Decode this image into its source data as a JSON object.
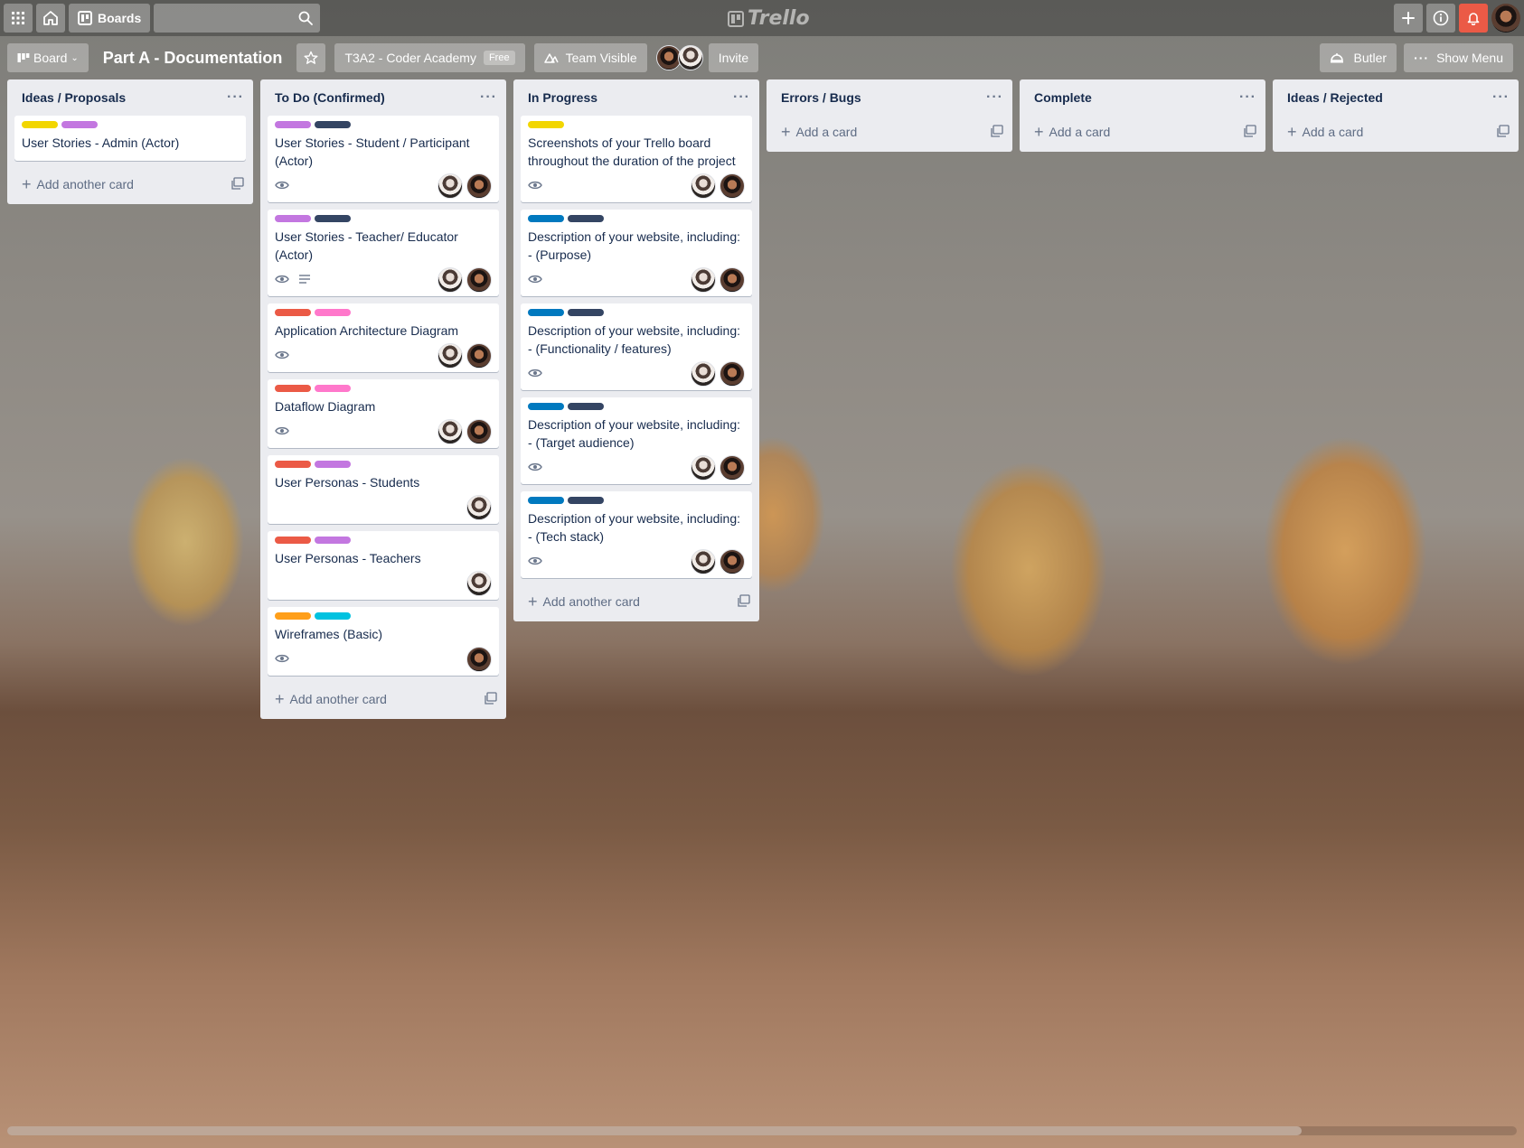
{
  "header": {
    "boards_label": "Boards",
    "logo_text": "Trello",
    "search_placeholder": ""
  },
  "board": {
    "view_label": "Board",
    "title": "Part A - Documentation",
    "team_label": "T3A2 - Coder Academy",
    "team_badge": "Free",
    "visibility_label": "Team Visible",
    "invite_label": "Invite",
    "butler_label": "Butler",
    "show_menu_label": "Show Menu"
  },
  "colors": {
    "yellow": "#f2d600",
    "purple": "#c377e0",
    "navy": "#344563",
    "red": "#eb5a46",
    "pink": "#ff78cb",
    "orange": "#ff9f1a",
    "sky": "#00c2e0",
    "blue": "#0079bf"
  },
  "lists": [
    {
      "title": "Ideas / Proposals",
      "add_label": "Add another card",
      "cards": [
        {
          "labels": [
            "yellow",
            "purple"
          ],
          "title": "User Stories - Admin (Actor)",
          "watch": false,
          "desc": false,
          "members": []
        }
      ]
    },
    {
      "title": "To Do (Confirmed)",
      "add_label": "Add another card",
      "cards": [
        {
          "labels": [
            "purple",
            "navy"
          ],
          "title": "User Stories - Student / Participant (Actor)",
          "watch": true,
          "desc": false,
          "members": [
            "a",
            "b"
          ]
        },
        {
          "labels": [
            "purple",
            "navy"
          ],
          "title": "User Stories - Teacher/ Educator (Actor)",
          "watch": true,
          "desc": true,
          "members": [
            "a",
            "b"
          ]
        },
        {
          "labels": [
            "red",
            "pink"
          ],
          "title": "Application Architecture Diagram",
          "watch": true,
          "desc": false,
          "members": [
            "a",
            "b"
          ]
        },
        {
          "labels": [
            "red",
            "pink"
          ],
          "title": "Dataflow Diagram",
          "watch": true,
          "desc": false,
          "members": [
            "a",
            "b"
          ]
        },
        {
          "labels": [
            "red",
            "purple"
          ],
          "title": "User Personas - Students",
          "watch": false,
          "desc": false,
          "members": [
            "a"
          ]
        },
        {
          "labels": [
            "red",
            "purple"
          ],
          "title": "User Personas - Teachers",
          "watch": false,
          "desc": false,
          "members": [
            "a"
          ]
        },
        {
          "labels": [
            "orange",
            "sky"
          ],
          "title": "Wireframes (Basic)",
          "watch": true,
          "desc": false,
          "members": [
            "b"
          ]
        }
      ]
    },
    {
      "title": "In Progress",
      "add_label": "Add another card",
      "cards": [
        {
          "labels": [
            "yellow"
          ],
          "title": "Screenshots of your Trello board throughout the duration of the project",
          "watch": true,
          "desc": false,
          "members": [
            "a",
            "b"
          ]
        },
        {
          "labels": [
            "blue",
            "navy"
          ],
          "title": "Description of your website, including: - (Purpose)",
          "watch": true,
          "desc": false,
          "members": [
            "a",
            "b"
          ]
        },
        {
          "labels": [
            "blue",
            "navy"
          ],
          "title": "Description of your website, including: - (Functionality / features)",
          "watch": true,
          "desc": false,
          "members": [
            "a",
            "b"
          ]
        },
        {
          "labels": [
            "blue",
            "navy"
          ],
          "title": "Description of your website, including: - (Target audience)",
          "watch": true,
          "desc": false,
          "members": [
            "a",
            "b"
          ]
        },
        {
          "labels": [
            "blue",
            "navy"
          ],
          "title": "Description of your website, including: - (Tech stack)",
          "watch": true,
          "desc": false,
          "members": [
            "a",
            "b"
          ]
        }
      ]
    },
    {
      "title": "Errors / Bugs",
      "add_label": "Add a card",
      "cards": []
    },
    {
      "title": "Complete",
      "add_label": "Add a card",
      "cards": []
    },
    {
      "title": "Ideas / Rejected",
      "add_label": "Add a card",
      "cards": []
    }
  ]
}
